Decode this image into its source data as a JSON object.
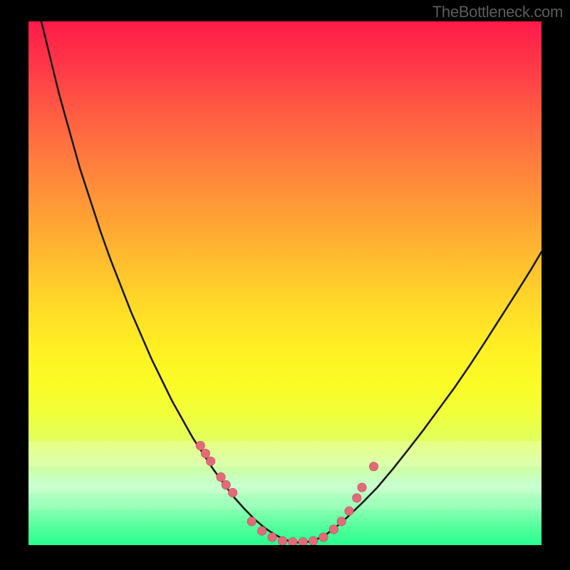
{
  "watermark": "TheBottleneck.com",
  "colors": {
    "frame": "#000000",
    "curve_stroke": "#1a1a1a",
    "marker_fill": "#e46a79",
    "marker_stroke": "#b84a58"
  },
  "chart_data": {
    "type": "line",
    "title": "",
    "xlabel": "",
    "ylabel": "",
    "xlim": [
      0,
      100
    ],
    "ylim": [
      0,
      100
    ],
    "curve": {
      "x": [
        0,
        2,
        4,
        6,
        8,
        10,
        12,
        14,
        16,
        18,
        20,
        22,
        24,
        26,
        28,
        30,
        32,
        34,
        36,
        38,
        40,
        42,
        44,
        46,
        48,
        50,
        52,
        54,
        56,
        58,
        60,
        62,
        65,
        68,
        71,
        74,
        77,
        80,
        83,
        86,
        89,
        92,
        95,
        98,
        100
      ],
      "y": [
        110,
        102,
        94,
        86,
        79,
        72,
        66,
        60,
        54.5,
        49.5,
        44.5,
        40,
        35.5,
        31.5,
        27.5,
        24,
        20.5,
        17.5,
        14.5,
        11.8,
        9.2,
        7,
        5,
        3.3,
        2,
        1,
        0.5,
        0.5,
        1,
        2,
        3.5,
        5.2,
        8,
        11,
        14.5,
        18.2,
        22,
        26,
        30,
        34.3,
        38.8,
        43.4,
        48,
        52.7,
        56
      ]
    },
    "markers": {
      "x": [
        33.5,
        34.5,
        35.5,
        37.5,
        38.5,
        39.8,
        43.5,
        45.5,
        47.5,
        49.5,
        51.5,
        53.5,
        55.5,
        57.5,
        59.5,
        61,
        62.5,
        64,
        65,
        67.3
      ],
      "y": [
        19,
        17.5,
        16,
        13,
        11.5,
        10,
        4.5,
        2.7,
        1.5,
        0.8,
        0.6,
        0.6,
        0.8,
        1.5,
        3,
        4.5,
        6.5,
        9,
        11,
        15
      ]
    },
    "background_gradient": {
      "top": "#ff1a49",
      "mid": "#fff123",
      "bottom": "#27ff8e"
    }
  }
}
